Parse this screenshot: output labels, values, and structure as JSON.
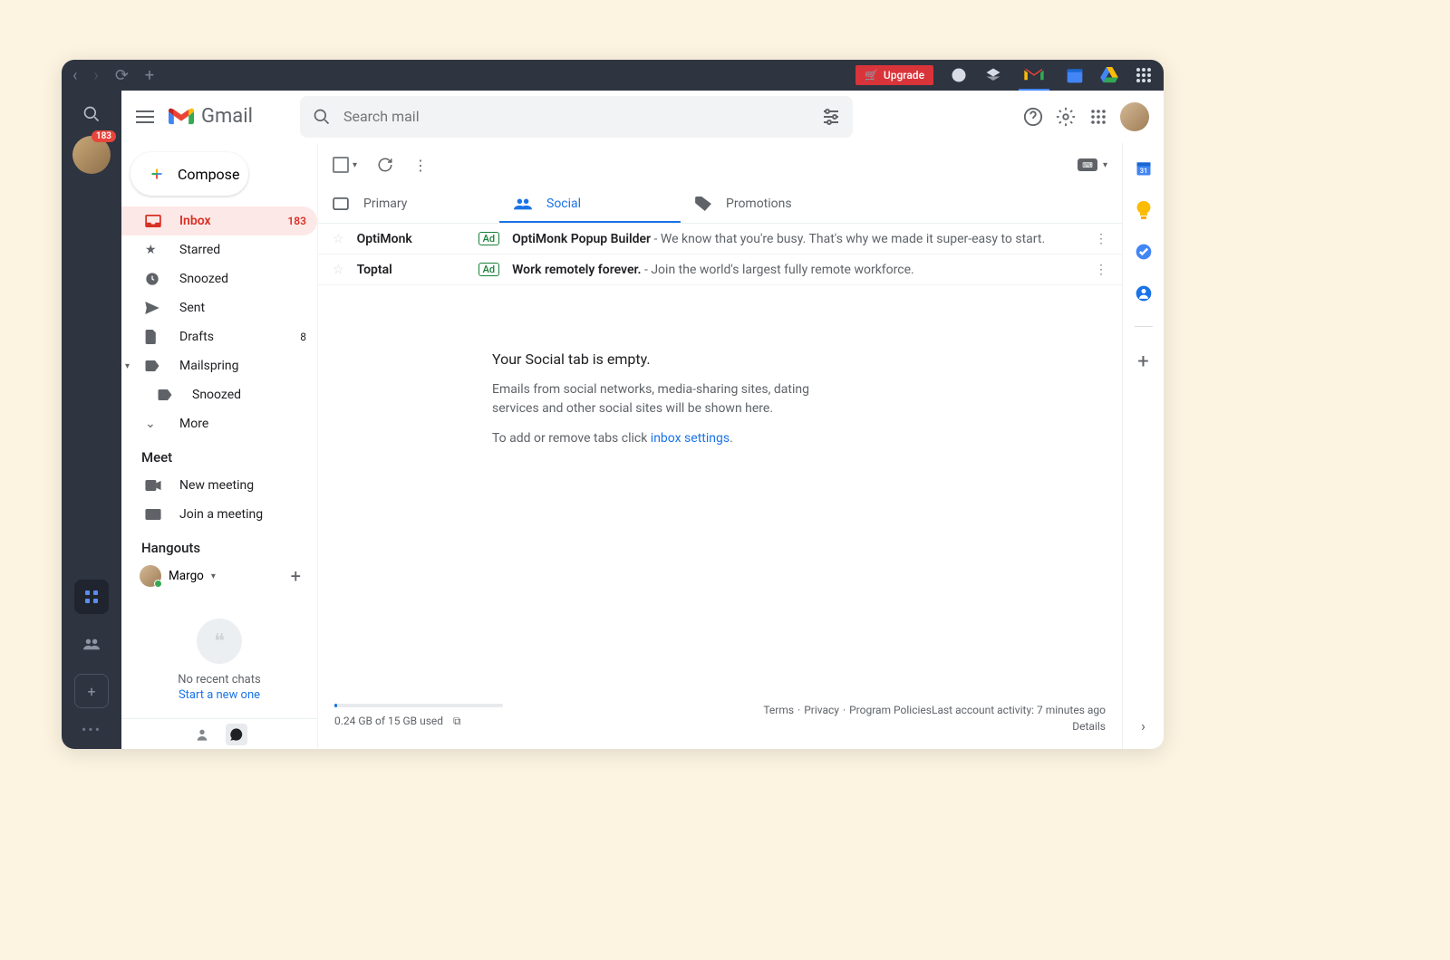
{
  "titlebar": {
    "upgrade": "Upgrade"
  },
  "rail": {
    "badge": "183"
  },
  "header": {
    "brand": "Gmail",
    "search_placeholder": "Search mail"
  },
  "compose": {
    "label": "Compose"
  },
  "nav": {
    "inbox": "Inbox",
    "inbox_count": "183",
    "starred": "Starred",
    "snoozed": "Snoozed",
    "sent": "Sent",
    "drafts": "Drafts",
    "drafts_count": "8",
    "mailspring": "Mailspring",
    "mailspring_snoozed": "Snoozed",
    "more": "More"
  },
  "meet": {
    "header": "Meet",
    "new": "New meeting",
    "join": "Join a meeting"
  },
  "hangouts": {
    "header": "Hangouts",
    "user": "Margo",
    "empty": "No recent chats",
    "start": "Start a new one"
  },
  "tabs": {
    "primary": "Primary",
    "social": "Social",
    "promotions": "Promotions"
  },
  "ads": [
    {
      "sender": "OptiMonk",
      "pill": "Ad",
      "subject": "OptiMonk Popup Builder",
      "preview": " - We know that you're busy. That's why we made it super-easy to start."
    },
    {
      "sender": "Toptal",
      "pill": "Ad",
      "subject": "Work remotely forever.",
      "preview": " - Join the world's largest fully remote workforce."
    }
  ],
  "empty": {
    "title": "Your Social tab is empty.",
    "line1": "Emails from social networks, media-sharing sites, dating services and other social sites will be shown here.",
    "line2a": "To add or remove tabs click ",
    "link": "inbox settings",
    "line2b": "."
  },
  "footer": {
    "storage": "0.24 GB of 15 GB used",
    "terms": "Terms",
    "privacy": "Privacy",
    "policies": "Program Policies",
    "activity": "Last account activity: 7 minutes ago",
    "details": "Details"
  }
}
